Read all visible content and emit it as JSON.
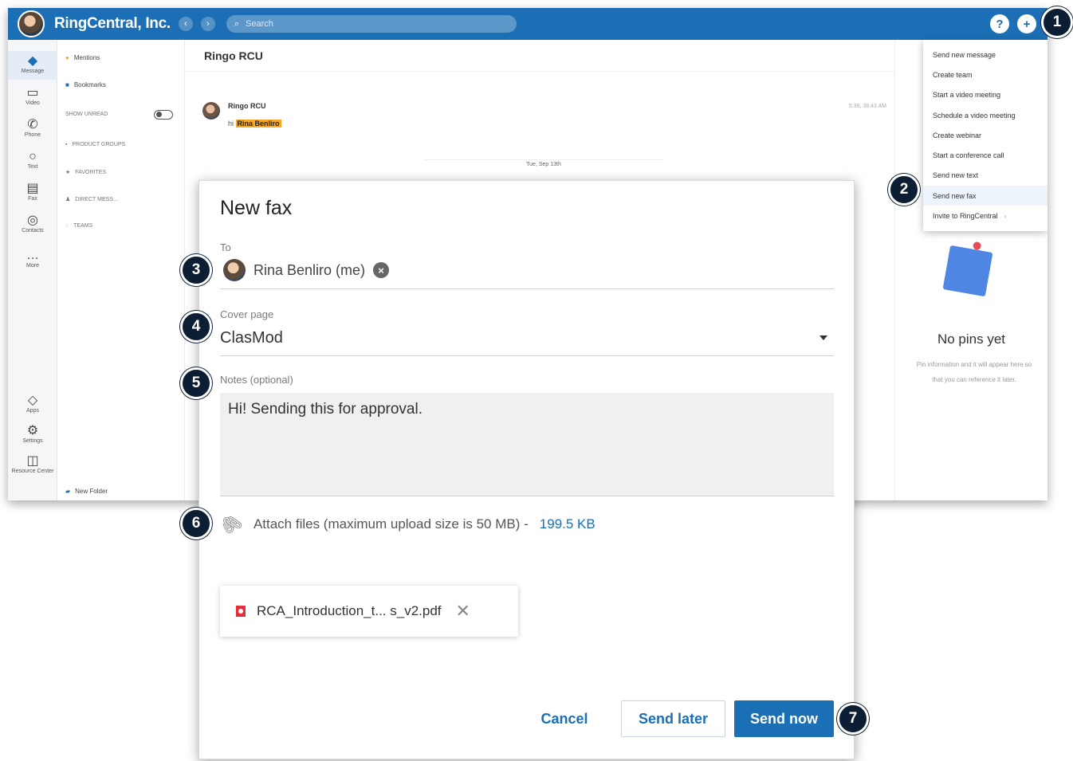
{
  "app": {
    "company_name": "RingCentral, Inc.",
    "search_placeholder": "Search",
    "nav_rail": [
      {
        "label": "Message",
        "icon": "message-icon"
      },
      {
        "label": "Video",
        "icon": "video-icon"
      },
      {
        "label": "Phone",
        "icon": "phone-icon"
      },
      {
        "label": "Text",
        "icon": "text-icon"
      },
      {
        "label": "Fax",
        "icon": "fax-icon"
      },
      {
        "label": "Contacts",
        "icon": "contacts-icon"
      },
      {
        "label": "More",
        "icon": "more-icon"
      },
      {
        "label": "Apps",
        "icon": "apps-icon"
      },
      {
        "label": "Settings",
        "icon": "settings-icon"
      },
      {
        "label": "Resource Center",
        "icon": "resource-center-icon"
      }
    ],
    "list_panel": {
      "mentions": "Mentions",
      "bookmarks": "Bookmarks",
      "show_unread": "SHOW UNREAD",
      "sections": [
        "PRODUCT GROUPS",
        "FAVORITES",
        "DIRECT MESS...",
        "TEAMS"
      ],
      "new_folder": "New Folder"
    },
    "chat": {
      "title": "Ringo RCU",
      "message_sender": "Ringo RCU",
      "message_prefix": "hi",
      "message_mention": "Rina Benliro",
      "message_time": "5:36, 38:43 AM",
      "date_divider": "Tue, Sep 13th"
    },
    "pins": {
      "title": "No pins yet",
      "description": "Pin information and it will appear here so that you can reference it later."
    },
    "new_menu": [
      "Send new message",
      "Create team",
      "Start a video meeting",
      "Schedule a video meeting",
      "Create webinar",
      "Start a conference call",
      "Send new text",
      "Send new fax",
      "Invite to RingCentral"
    ]
  },
  "dialog": {
    "title": "New fax",
    "to_label": "To",
    "recipient": "Rina Benliro (me)",
    "cover_label": "Cover page",
    "cover_value": "ClasMod",
    "notes_label": "Notes (optional)",
    "notes_value": "Hi! Sending this for approval.",
    "attach_text": "Attach files (maximum upload size is 50 MB) -",
    "attach_size": "199.5 KB",
    "file_name": "RCA_Introduction_t... s_v2.pdf",
    "cancel": "Cancel",
    "send_later": "Send later",
    "send_now": "Send now"
  },
  "callouts": [
    "1",
    "2",
    "3",
    "4",
    "5",
    "6",
    "7"
  ],
  "colors": {
    "brand_blue": "#1a6fb5",
    "topbar": "#1c6fb5",
    "callout": "#0b1e33",
    "mention": "#f7a726",
    "pdf_red": "#e0303a"
  }
}
